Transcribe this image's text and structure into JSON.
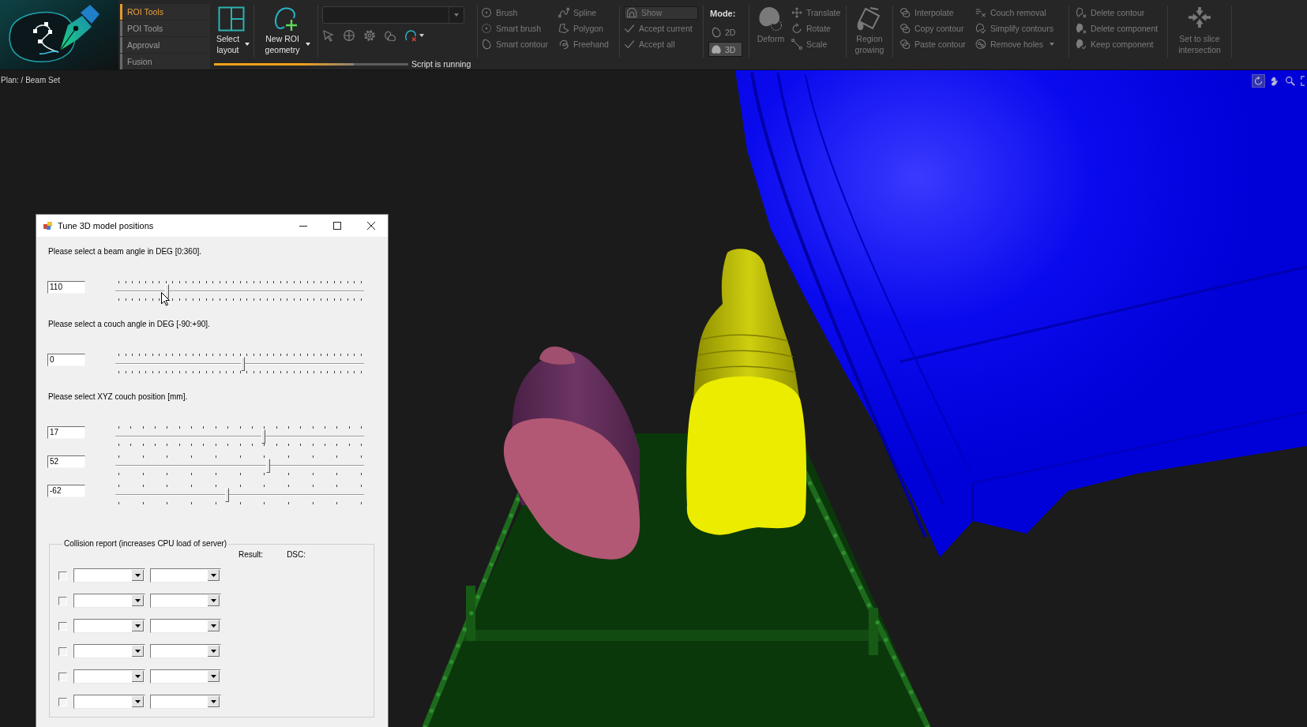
{
  "tabs": [
    {
      "label": "ROI Tools",
      "selected": true
    },
    {
      "label": "POI Tools",
      "selected": false
    },
    {
      "label": "Approval",
      "selected": false
    },
    {
      "label": "Fusion",
      "selected": false
    }
  ],
  "ribbon": {
    "layout_button": {
      "label": "Select layout",
      "menu": true
    },
    "geometry_button": {
      "label": "New ROI geometry",
      "menu": true
    },
    "script_progress": {
      "level": 0.72,
      "label": "Script is running"
    },
    "drawing_tools": [
      {
        "label": "Brush",
        "disabled": true
      },
      {
        "label": "Smart brush",
        "disabled": true
      },
      {
        "label": "Smart contour",
        "disabled": true
      },
      {
        "label": "Spline",
        "disabled": true
      },
      {
        "label": "Polygon",
        "disabled": true
      },
      {
        "label": "Freehand",
        "disabled": true
      }
    ],
    "accept_tools": [
      {
        "kind": "field",
        "label": "Show",
        "disabled": true
      },
      {
        "kind": "check",
        "label": "Accept current",
        "disabled": true
      },
      {
        "kind": "check",
        "label": "Accept all",
        "disabled": true
      }
    ],
    "mode": {
      "label": "Mode:",
      "options": [
        {
          "label": "2D",
          "selected": false
        },
        {
          "label": "3D",
          "selected": true
        }
      ]
    },
    "deform_button": {
      "label": "Deform",
      "disabled": true
    },
    "transform_tools": [
      {
        "label": "Translate",
        "disabled": true
      },
      {
        "label": "Rotate",
        "disabled": true
      },
      {
        "label": "Scale",
        "disabled": true
      }
    ],
    "region_growing_button": {
      "label": "Region growing",
      "disabled": true
    },
    "contour_tools": [
      {
        "label": "Interpolate",
        "disabled": true,
        "menu": false
      },
      {
        "label": "Copy contour",
        "disabled": true,
        "menu": false
      },
      {
        "label": "Paste contour",
        "disabled": true,
        "menu": false
      },
      {
        "label": "Couch removal",
        "disabled": true,
        "menu": false
      },
      {
        "label": "Simplify contours",
        "disabled": true,
        "menu": false
      },
      {
        "label": "Remove holes",
        "disabled": true,
        "menu": true
      }
    ],
    "component_tools": [
      {
        "label": "Delete contour",
        "disabled": true
      },
      {
        "label": "Delete component",
        "disabled": true
      },
      {
        "label": "Keep component",
        "disabled": true
      }
    ],
    "slice_button": {
      "label": "Set to slice intersection",
      "disabled": true
    }
  },
  "viewport": {
    "breadcrumb": "Plan: / Beam Set",
    "view_tools": [
      {
        "selected": true
      },
      {
        "selected": false
      },
      {
        "selected": false
      },
      {
        "selected": false
      }
    ]
  },
  "dialog": {
    "title": "Tune 3D model positions",
    "sections": [
      {
        "prompt": "Please select a beam angle in DEG [0:360].",
        "sliders": [
          {
            "value": "110",
            "level": 0.2
          }
        ]
      },
      {
        "prompt": "Please select a couch angle in DEG [-90:+90].",
        "sliders": [
          {
            "value": "0",
            "level": 0.51
          }
        ]
      },
      {
        "prompt": "Please select XYZ couch position [mm].",
        "sliders": [
          {
            "value": "17",
            "level": 0.596
          },
          {
            "value": "52",
            "level": 0.616
          },
          {
            "value": "-62",
            "level": 0.445
          }
        ]
      }
    ],
    "collision_report": {
      "title": "Collision report (increases CPU load of server)",
      "columns": [
        "Result:",
        "DSC:"
      ],
      "rows": [
        {
          "checked": false
        },
        {
          "checked": false
        },
        {
          "checked": false
        },
        {
          "checked": false
        },
        {
          "checked": false
        },
        {
          "checked": false
        }
      ]
    }
  }
}
